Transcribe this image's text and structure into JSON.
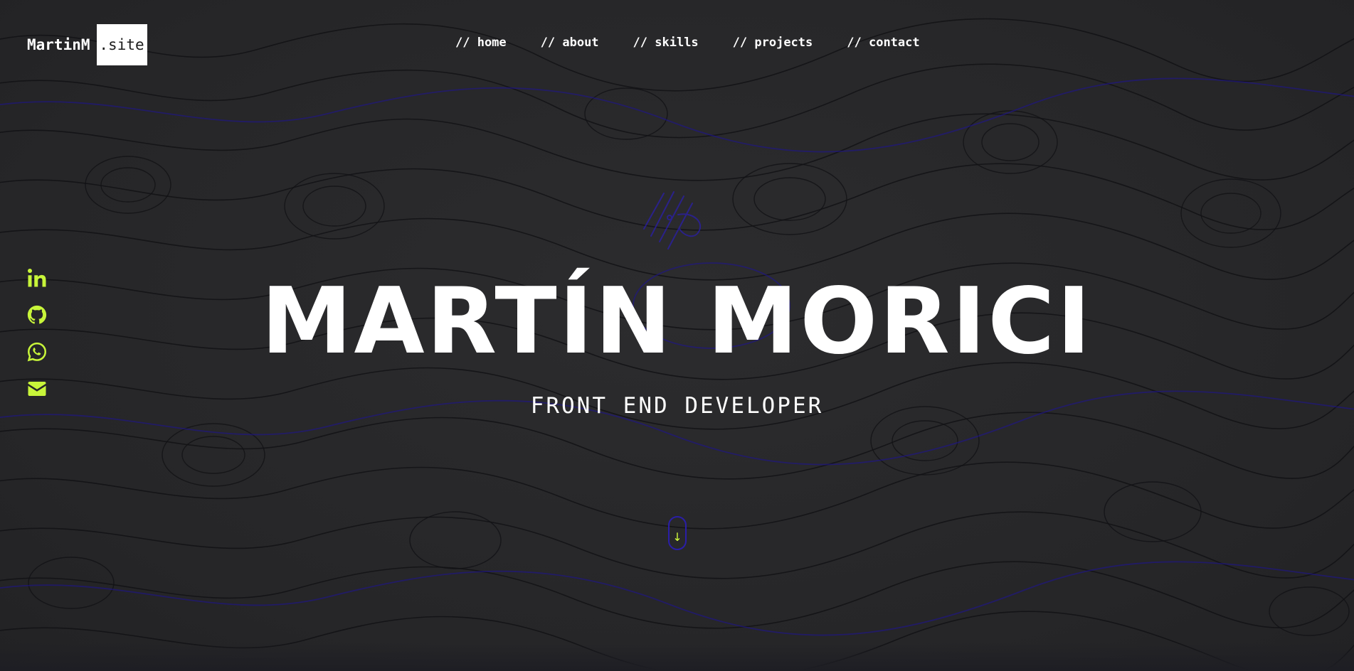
{
  "logo": {
    "name": "MartinM",
    "suffix": ".site"
  },
  "nav": {
    "items": [
      {
        "label": "// home"
      },
      {
        "label": "// about"
      },
      {
        "label": "// skills"
      },
      {
        "label": "// projects"
      },
      {
        "label": "// contact"
      }
    ]
  },
  "social": {
    "icons": [
      "linkedin-icon",
      "github-icon",
      "whatsapp-icon",
      "email-icon"
    ],
    "color": "#c8f53a"
  },
  "hero": {
    "name": "MARTÍN MORICI",
    "role": "FRONT END DEVELOPER"
  },
  "scroll_indicator": {
    "arrow": "↓",
    "border_color": "#2a1ea8",
    "arrow_color": "#d4ff3a"
  },
  "theme": {
    "background": "#28282a",
    "topo_line": "#111114",
    "topo_accent": "#1e1490",
    "text": "#ffffff"
  }
}
